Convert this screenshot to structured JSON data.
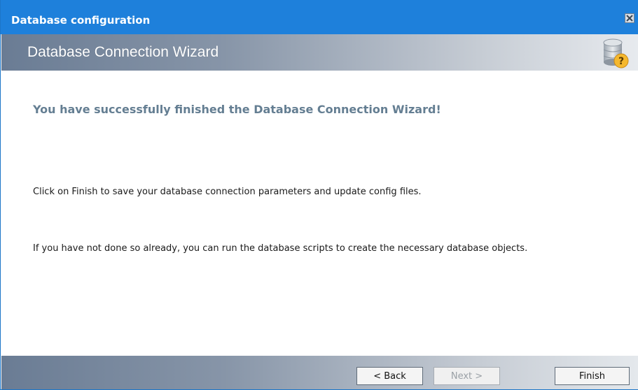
{
  "window": {
    "title": "Database configuration"
  },
  "banner": {
    "title": "Database Connection Wizard",
    "icon": "database-help-icon"
  },
  "content": {
    "heading": "You have successfully finished the Database Connection Wizard!",
    "paragraph1": "Click on Finish to save your database connection parameters and update config files.",
    "paragraph2": "If you have not done so already, you can run the database scripts to create the necessary database objects."
  },
  "buttons": {
    "back": "< Back",
    "next": "Next >",
    "finish": "Finish"
  },
  "colors": {
    "titlebar": "#1e80db",
    "heading": "#647e92"
  }
}
